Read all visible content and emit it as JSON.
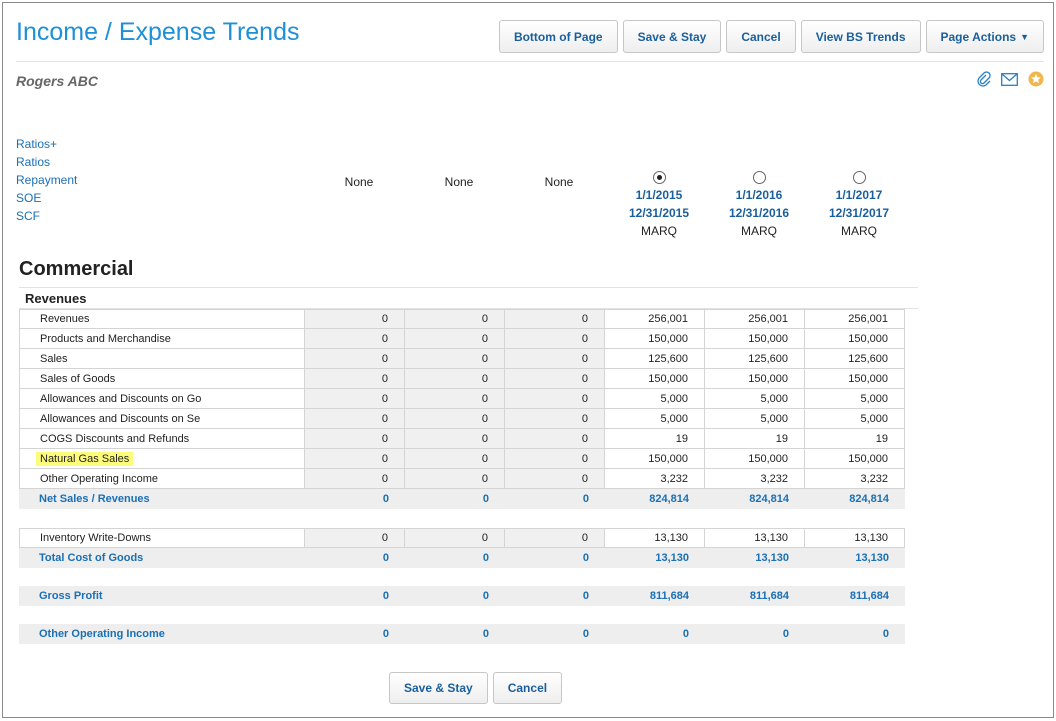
{
  "header": {
    "title": "Income / Expense Trends",
    "buttons": {
      "bottom": "Bottom of Page",
      "save_stay": "Save & Stay",
      "cancel": "Cancel",
      "view_bs": "View BS Trends",
      "page_actions": "Page Actions"
    }
  },
  "company": "Rogers ABC",
  "icons": [
    "paperclip-icon",
    "mail-icon",
    "star-icon"
  ],
  "nav_links": [
    "Ratios+",
    "Ratios",
    "Repayment",
    "SOE",
    "SCF"
  ],
  "columns": {
    "empty": [
      "None",
      "None",
      "None"
    ],
    "periods": [
      {
        "start": "1/1/2015",
        "end": "12/31/2015",
        "source": "MARQ",
        "selected": true
      },
      {
        "start": "1/1/2016",
        "end": "12/31/2016",
        "source": "MARQ",
        "selected": false
      },
      {
        "start": "1/1/2017",
        "end": "12/31/2017",
        "source": "MARQ",
        "selected": false
      }
    ]
  },
  "section": "Commercial",
  "group": "Revenues",
  "revenue_rows": [
    {
      "label": "Revenues",
      "values": [
        "0",
        "0",
        "0",
        "256,001",
        "256,001",
        "256,001"
      ]
    },
    {
      "label": "Products and Merchandise",
      "values": [
        "0",
        "0",
        "0",
        "150,000",
        "150,000",
        "150,000"
      ]
    },
    {
      "label": "Sales",
      "values": [
        "0",
        "0",
        "0",
        "125,600",
        "125,600",
        "125,600"
      ]
    },
    {
      "label": "Sales of Goods",
      "values": [
        "0",
        "0",
        "0",
        "150,000",
        "150,000",
        "150,000"
      ]
    },
    {
      "label": "Allowances and Discounts on Go",
      "values": [
        "0",
        "0",
        "0",
        "5,000",
        "5,000",
        "5,000"
      ]
    },
    {
      "label": "Allowances and Discounts on Se",
      "values": [
        "0",
        "0",
        "0",
        "5,000",
        "5,000",
        "5,000"
      ]
    },
    {
      "label": "COGS Discounts and Refunds",
      "values": [
        "0",
        "0",
        "0",
        "19",
        "19",
        "19"
      ]
    },
    {
      "label": "Natural Gas Sales",
      "values": [
        "0",
        "0",
        "0",
        "150,000",
        "150,000",
        "150,000"
      ],
      "highlight": true
    },
    {
      "label": "Other Operating Income",
      "values": [
        "0",
        "0",
        "0",
        "3,232",
        "3,232",
        "3,232"
      ]
    }
  ],
  "net_sales": {
    "label": "Net Sales / Revenues",
    "values": [
      "0",
      "0",
      "0",
      "824,814",
      "824,814",
      "824,814"
    ]
  },
  "cogs_rows": [
    {
      "label": "Inventory Write-Downs",
      "values": [
        "0",
        "0",
        "0",
        "13,130",
        "13,130",
        "13,130"
      ]
    }
  ],
  "total_cogs": {
    "label": "Total Cost of Goods",
    "values": [
      "0",
      "0",
      "0",
      "13,130",
      "13,130",
      "13,130"
    ]
  },
  "gross_profit": {
    "label": "Gross Profit",
    "values": [
      "0",
      "0",
      "0",
      "811,684",
      "811,684",
      "811,684"
    ]
  },
  "other_operating": {
    "label": "Other Operating Income",
    "values": [
      "0",
      "0",
      "0",
      "0",
      "0",
      "0"
    ]
  },
  "footer": {
    "save_stay": "Save & Stay",
    "cancel": "Cancel"
  },
  "colors": {
    "accent": "#1e90d6",
    "link": "#1a6fb5",
    "highlight": "#fdfc7a",
    "star": "#f0b64a"
  }
}
